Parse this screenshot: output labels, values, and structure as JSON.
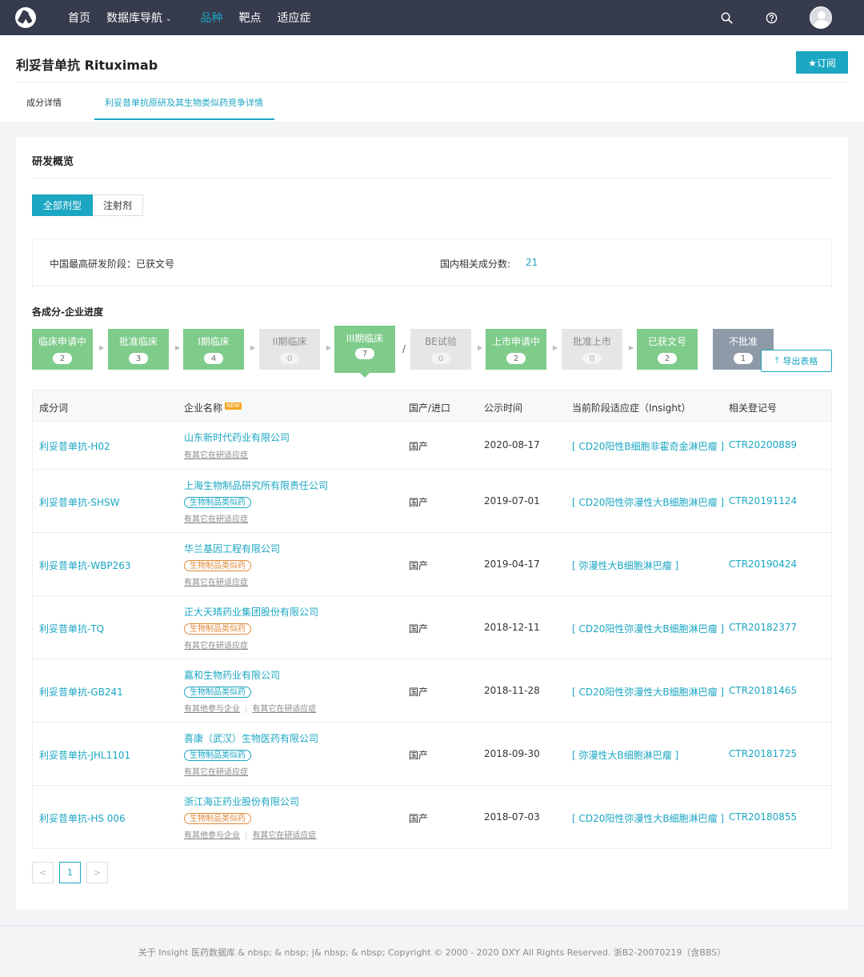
{
  "nav": {
    "items": [
      "首页",
      "数据库导航",
      "品种",
      "靶点",
      "适应症"
    ],
    "caret": "⌄"
  },
  "header": {
    "title": "利妥昔单抗 Rituximab",
    "subscribe": "★订阅",
    "tabs": [
      "成分详情",
      "利妥昔单抗原研及其生物类似药竞争详情"
    ]
  },
  "overview": {
    "title": "研发概览",
    "dosage_tabs": [
      "全部剂型",
      "注射剂"
    ],
    "highest_stage_label": "中国最高研发阶段：已获文号",
    "related_count_label": "国内相关成分数:",
    "related_count_value": "21"
  },
  "progress": {
    "title": "各成分-企业进度",
    "stages": [
      {
        "label": "临床申请中",
        "count": "2"
      },
      {
        "label": "批准临床",
        "count": "3"
      },
      {
        "label": "I期临床",
        "count": "4"
      },
      {
        "label": "II期临床",
        "count": "0"
      },
      {
        "label": "III期临床",
        "count": "7"
      },
      {
        "label": "BE试验",
        "count": "0"
      },
      {
        "label": "上市申请中",
        "count": "2"
      },
      {
        "label": "批准上市",
        "count": "0"
      },
      {
        "label": "已获文号",
        "count": "2"
      },
      {
        "label": "不批准",
        "count": "1"
      }
    ],
    "arrow": "▶",
    "slash": "/",
    "export": "导出表格",
    "export_icon": "⤒"
  },
  "table": {
    "headers": [
      "成分词",
      "企业名称",
      "国产/进口",
      "公示时间",
      "当前阶段适应症（Insight）",
      "相关登记号"
    ],
    "new_badge": "NEW",
    "rows": [
      {
        "name": "利妥昔单抗-H02",
        "company": "山东新时代药业有限公司",
        "tag": "",
        "tag_color": "",
        "links": [
          "有其它在研适应症"
        ],
        "origin": "国产",
        "date": "2020-08-17",
        "indication": "[ CD20阳性B细胞非霍奇金淋巴瘤 ]",
        "reg": "CTR20200889"
      },
      {
        "name": "利妥昔单抗-SHSW",
        "company": "上海生物制品研究所有限责任公司",
        "tag": "生物制品类似药",
        "tag_color": "blue",
        "links": [
          "有其它在研适应症"
        ],
        "origin": "国产",
        "date": "2019-07-01",
        "indication": "[ CD20阳性弥漫性大B细胞淋巴瘤 ]",
        "reg": "CTR20191124"
      },
      {
        "name": "利妥昔单抗-WBP263",
        "company": "华兰基因工程有限公司",
        "tag": "生物制品类似药",
        "tag_color": "orange",
        "links": [
          "有其它在研适应症"
        ],
        "origin": "国产",
        "date": "2019-04-17",
        "indication": "[ 弥漫性大B细胞淋巴瘤 ]",
        "reg": "CTR20190424"
      },
      {
        "name": "利妥昔单抗-TQ",
        "company": "正大天晴药业集团股份有限公司",
        "tag": "生物制品类似药",
        "tag_color": "orange",
        "links": [
          "有其它在研适应症"
        ],
        "origin": "国产",
        "date": "2018-12-11",
        "indication": "[ CD20阳性弥漫性大B细胞淋巴瘤 ]",
        "reg": "CTR20182377"
      },
      {
        "name": "利妥昔单抗-GB241",
        "company": "嘉和生物药业有限公司",
        "tag": "生物制品类似药",
        "tag_color": "blue",
        "links": [
          "有其他参与企业",
          "有其它在研适应症"
        ],
        "origin": "国产",
        "date": "2018-11-28",
        "indication": "[ CD20阳性弥漫性大B细胞淋巴瘤 ]",
        "reg": "CTR20181465"
      },
      {
        "name": "利妥昔单抗-JHL1101",
        "company": "喜康（武汉）生物医药有限公司",
        "tag": "生物制品类似药",
        "tag_color": "blue",
        "links": [
          "有其它在研适应症"
        ],
        "origin": "国产",
        "date": "2018-09-30",
        "indication": "[ 弥漫性大B细胞淋巴瘤 ]",
        "reg": "CTR20181725"
      },
      {
        "name": "利妥昔单抗-HS 006",
        "company": "浙江海正药业股份有限公司",
        "tag": "生物制品类似药",
        "tag_color": "orange",
        "links": [
          "有其他参与企业",
          "有其它在研适应症"
        ],
        "origin": "国产",
        "date": "2018-07-03",
        "indication": "[ CD20阳性弥漫性大B细胞淋巴瘤 ]",
        "reg": "CTR20180855"
      }
    ]
  },
  "pager": {
    "prev": "<",
    "current": "1",
    "next": ">"
  },
  "footer": "关于 Insight 医药数据库 & nbsp; & nbsp; |& nbsp; & nbsp; Copyright © 2000 - 2020 DXY All Rights Reserved. 浙B2-20070219（含BBS）",
  "colors": {
    "accent": "#1ba6c2",
    "nav_bg": "#363b4d",
    "stage_green": "#7ecb8a",
    "stage_gray": "#e4e6e8",
    "stage_dark": "#8e9aa8",
    "tag_orange": "#e08a3c"
  }
}
